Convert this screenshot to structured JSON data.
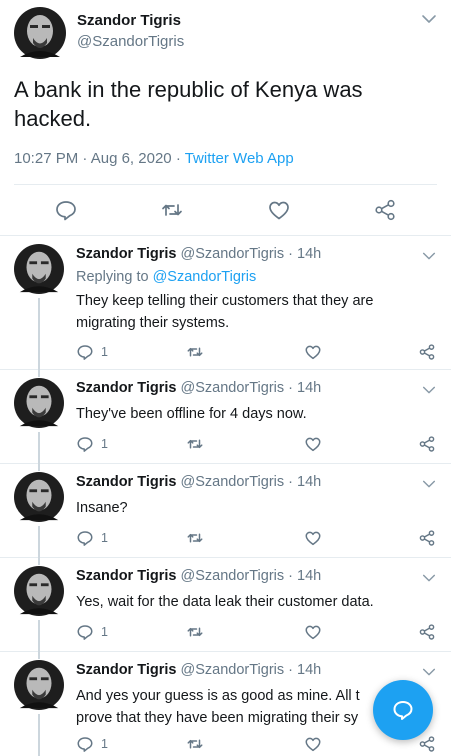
{
  "main_tweet": {
    "author_name": "Szandor Tigris",
    "author_handle": "@SzandorTigris",
    "text": "A bank in the republic of Kenya was hacked.",
    "time": "10:27 PM",
    "date": "Aug 6, 2020",
    "separator": "·",
    "source_app": "Twitter Web App",
    "icons": [
      "reply-icon",
      "retweet-icon",
      "like-icon",
      "share-icon"
    ]
  },
  "replies": [
    {
      "author_name": "Szandor Tigris",
      "author_handle": "@SzandorTigris",
      "separator": "·",
      "time": "14h",
      "replying_prefix": "Replying to",
      "replying_to": "@SzandorTigris",
      "text": "They keep telling their customers that they are migrating their systems.",
      "reply_count": "1"
    },
    {
      "author_name": "Szandor Tigris",
      "author_handle": "@SzandorTigris",
      "separator": "·",
      "time": "14h",
      "text": "They've been offline for 4 days now.",
      "reply_count": "1"
    },
    {
      "author_name": "Szandor Tigris",
      "author_handle": "@SzandorTigris",
      "separator": "·",
      "time": "14h",
      "text": "Insane?",
      "reply_count": "1"
    },
    {
      "author_name": "Szandor Tigris",
      "author_handle": "@SzandorTigris",
      "separator": "·",
      "time": "14h",
      "text": "Yes, wait for the data leak their customer data.",
      "reply_count": "1"
    },
    {
      "author_name": "Szandor Tigris",
      "author_handle": "@SzandorTigris",
      "separator": "·",
      "time": "14h",
      "text": "And yes your guess is as good as mine. All t",
      "text_line2": "prove that they have been migrating their sy",
      "reply_count": "1"
    }
  ],
  "compose_button": {
    "icon": "compose-bubble-icon"
  },
  "colors": {
    "accent": "#1da1f2",
    "text": "#14171a",
    "muted": "#657786",
    "border": "#e6ecf0"
  }
}
